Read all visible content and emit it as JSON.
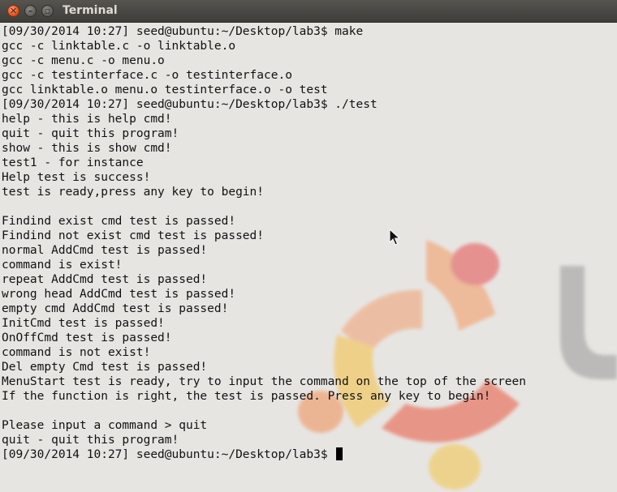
{
  "window": {
    "title": "Terminal"
  },
  "titlebar_buttons": [
    {
      "name": "close",
      "glyph": "✕"
    },
    {
      "name": "minimize",
      "glyph": "–"
    },
    {
      "name": "maximize",
      "glyph": "▫"
    }
  ],
  "terminal": {
    "lines": [
      "[09/30/2014 10:27] seed@ubuntu:~/Desktop/lab3$ make",
      "gcc -c linktable.c -o linktable.o",
      "gcc -c menu.c -o menu.o",
      "gcc -c testinterface.c -o testinterface.o",
      "gcc linktable.o menu.o testinterface.o -o test",
      "[09/30/2014 10:27] seed@ubuntu:~/Desktop/lab3$ ./test",
      "help - this is help cmd!",
      "quit - quit this program!",
      "show - this is show cmd!",
      "test1 - for instance",
      "Help test is success!",
      "test is ready,press any key to begin!",
      "",
      "Findind exist cmd test is passed!",
      "Findind not exist cmd test is passed!",
      "normal AddCmd test is passed!",
      "command is exist!",
      "repeat AddCmd test is passed!",
      "wrong head AddCmd test is passed!",
      "empty cmd AddCmd test is passed!",
      "InitCmd test is passed!",
      "OnOffCmd test is passed!",
      "command is not exist!",
      "Del empty Cmd test is passed!",
      "MenuStart test is ready, try to input the command on the top of the screen",
      "If the function is right, the test is passed. Press any key to begin!",
      "",
      "Please input a command > quit",
      "quit - quit this program!"
    ],
    "prompt": "[09/30/2014 10:27] seed@ubuntu:~/Desktop/lab3$ "
  },
  "colors": {
    "titlebar": "#3e3d39",
    "title_text": "#dfdbd2",
    "close_button": "#df4a16",
    "terminal_bg": "#e7e5e2",
    "text": "#111111"
  }
}
